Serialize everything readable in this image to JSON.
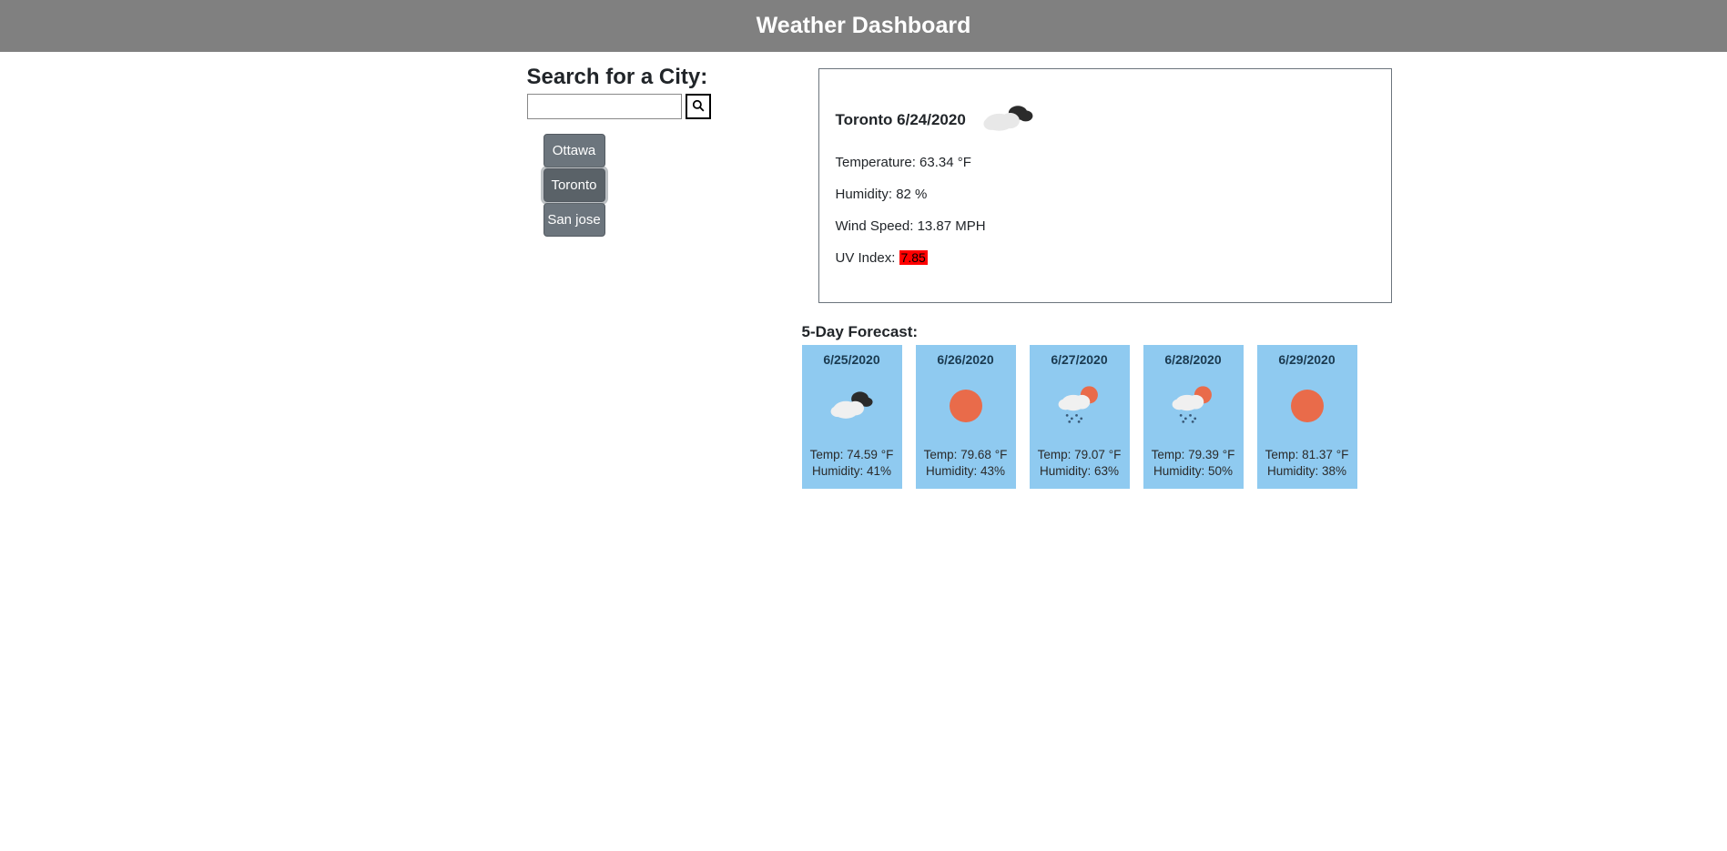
{
  "header": {
    "title": "Weather Dashboard"
  },
  "search": {
    "title": "Search for a City:",
    "value": "",
    "placeholder": ""
  },
  "history": {
    "items": [
      {
        "label": "Ottawa",
        "active": false
      },
      {
        "label": "Toronto",
        "active": true
      },
      {
        "label": "San jose",
        "active": false
      }
    ]
  },
  "current": {
    "city": "Toronto",
    "date": "6/24/2020",
    "icon": "clouds",
    "temperature_label": "Temperature: ",
    "temperature_value": "63.34 °F",
    "humidity_label": "Humidity: ",
    "humidity_value": "82 %",
    "wind_label": "Wind Speed: ",
    "wind_value": "13.87 MPH",
    "uv_label": "UV Index: ",
    "uv_value": "7.85",
    "uv_color": "#ff0000"
  },
  "forecast": {
    "title": "5-Day Forecast:",
    "days": [
      {
        "date": "6/25/2020",
        "icon": "cloud-sun-dark",
        "temp": "Temp: 74.59 °F",
        "humidity": "Humidity: 41%"
      },
      {
        "date": "6/26/2020",
        "icon": "sun",
        "temp": "Temp: 79.68 °F",
        "humidity": "Humidity: 43%"
      },
      {
        "date": "6/27/2020",
        "icon": "rain-sun",
        "temp": "Temp: 79.07 °F",
        "humidity": "Humidity: 63%"
      },
      {
        "date": "6/28/2020",
        "icon": "rain-sun",
        "temp": "Temp: 79.39 °F",
        "humidity": "Humidity: 50%"
      },
      {
        "date": "6/29/2020",
        "icon": "sun",
        "temp": "Temp: 81.37 °F",
        "humidity": "Humidity: 38%"
      }
    ]
  }
}
